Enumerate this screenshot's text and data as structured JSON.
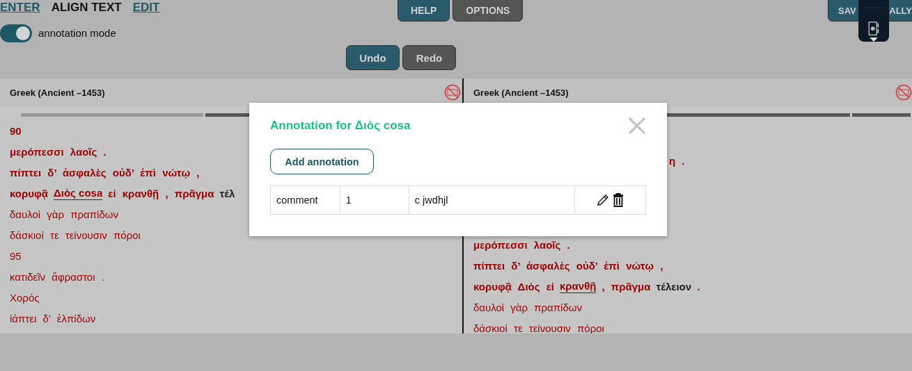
{
  "nav": {
    "tabs": [
      {
        "label": "ENTER",
        "selected": false
      },
      {
        "label": "ALIGN TEXT",
        "selected": true
      },
      {
        "label": "EDIT",
        "selected": false
      }
    ],
    "annotation_toggle": {
      "label": "annotation mode",
      "on": true
    }
  },
  "toolbar": {
    "buttons": [
      {
        "label": "HELP",
        "kind": "primary"
      },
      {
        "label": "OPTIONS",
        "kind": "secondary"
      }
    ],
    "save_button": {
      "label_parts": [
        "SAV",
        "ALLY"
      ]
    }
  },
  "history_buttons": [
    {
      "label": "Undo",
      "kind": "primary"
    },
    {
      "label": "Redo",
      "kind": "secondary"
    }
  ],
  "panels": [
    {
      "language": "Greek (Ancient –1453)",
      "lines": [
        {
          "kind": "line",
          "segments": [
            {
              "text": "90",
              "kind": "bold"
            }
          ]
        },
        {
          "kind": "line",
          "segments": [
            {
              "text": "μερόπεσσι λαοῖς .",
              "kind": "bold"
            }
          ]
        },
        {
          "kind": "line",
          "segments": [
            {
              "text": "πίπτει δ’ ἀσφαλὲς οὐδ’ ἐπὶ νώτῳ ,",
              "kind": "bold"
            }
          ]
        },
        {
          "kind": "line",
          "segments": [
            {
              "text": "κορυφᾷ",
              "kind": "bold"
            },
            {
              "text": "Διὸς cosa",
              "kind": "annotated"
            },
            {
              "text": "εἰ κρανθῇ , πρᾶγμα",
              "kind": "bold"
            },
            {
              "text": "τέλ",
              "kind": "dark"
            }
          ]
        },
        {
          "kind": "line",
          "segments": [
            {
              "text": "δαυλοὶ γὰρ πραπίδων",
              "kind": "plain"
            }
          ]
        },
        {
          "kind": "line",
          "segments": [
            {
              "text": "δάσκιοί τε τείνουσιν πόροι",
              "kind": "plain"
            }
          ]
        },
        {
          "kind": "line",
          "segments": [
            {
              "text": "95",
              "kind": "plain"
            }
          ]
        },
        {
          "kind": "line",
          "segments": [
            {
              "text": "κατιδεῖν ἄφραστοι .",
              "kind": "plain"
            }
          ]
        },
        {
          "kind": "line",
          "segments": [
            {
              "text": "Χορός",
              "kind": "plain"
            }
          ]
        },
        {
          "kind": "line",
          "segments": [
            {
              "text": "ἰάπτει δ’ ἐλπίδων",
              "kind": "plain"
            }
          ]
        }
      ]
    },
    {
      "language": "Greek (Ancient –1453)",
      "lines": [
        {
          "kind": "partial",
          "segments": [
            {
              "text": "η .",
              "kind": "bold"
            }
          ]
        },
        {
          "kind": "line",
          "segments": [
            {
              "text": "μερόπεσσι λαοῖς .",
              "kind": "bold"
            }
          ]
        },
        {
          "kind": "line",
          "segments": [
            {
              "text": "πίπτει δ’ ἀσφαλὲς οὐδ’ ἐπὶ νώτῳ ,",
              "kind": "bold"
            }
          ]
        },
        {
          "kind": "line",
          "segments": [
            {
              "text": "κορυφᾷ Διὸς εἰ",
              "kind": "bold"
            },
            {
              "text": "κρανθῇ",
              "kind": "annotated"
            },
            {
              "text": ", πρᾶγμα",
              "kind": "bold"
            },
            {
              "text": "τέλειον",
              "kind": "dark"
            },
            {
              "text": ".",
              "kind": "bold"
            }
          ]
        },
        {
          "kind": "line",
          "segments": [
            {
              "text": "δαυλοὶ γὰρ πραπίδων",
              "kind": "plain"
            }
          ]
        },
        {
          "kind": "line",
          "segments": [
            {
              "text": "δάσκιοί τε τείνουσιν πόροι",
              "kind": "plain"
            }
          ]
        }
      ]
    }
  ],
  "dialog": {
    "title": "Annotation for Διὸς cosa",
    "add_button": "Add annotation",
    "rows": [
      {
        "cells": [
          "comment",
          "1",
          "c jwdhjl"
        ]
      }
    ]
  }
}
